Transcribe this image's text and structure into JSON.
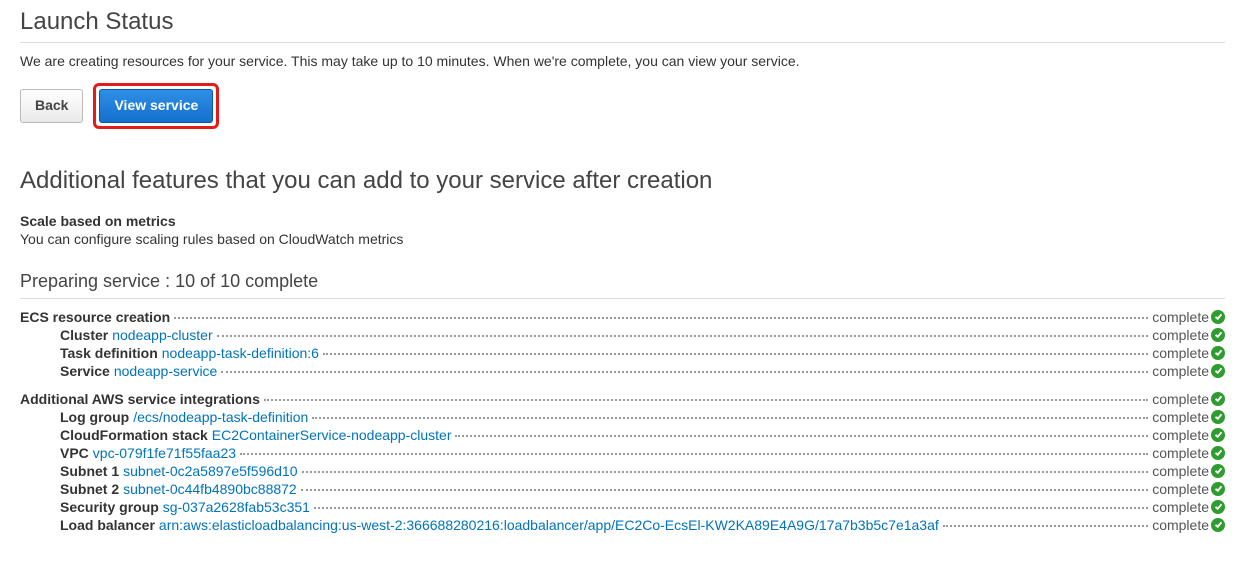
{
  "title": "Launch Status",
  "description": "We are creating resources for your service. This may take up to 10 minutes. When we're complete, you can view your service.",
  "buttons": {
    "back": "Back",
    "view_service": "View service"
  },
  "additional_heading": "Additional features that you can add to your service after creation",
  "feature": {
    "title": "Scale based on metrics",
    "desc": "You can configure scaling rules based on CloudWatch metrics"
  },
  "progress": {
    "heading": "Preparing service : 10 of 10 complete",
    "complete_label": "complete",
    "groups": [
      {
        "title": "ECS resource creation",
        "items": [
          {
            "label": "Cluster",
            "link": "nodeapp-cluster"
          },
          {
            "label": "Task definition",
            "link": "nodeapp-task-definition:6"
          },
          {
            "label": "Service",
            "link": "nodeapp-service"
          }
        ]
      },
      {
        "title": "Additional AWS service integrations",
        "items": [
          {
            "label": "Log group",
            "link": "/ecs/nodeapp-task-definition"
          },
          {
            "label": "CloudFormation stack",
            "link": "EC2ContainerService-nodeapp-cluster"
          },
          {
            "label": "VPC",
            "link": "vpc-079f1fe71f55faa23"
          },
          {
            "label": "Subnet 1",
            "link": "subnet-0c2a5897e5f596d10"
          },
          {
            "label": "Subnet 2",
            "link": "subnet-0c44fb4890bc88872"
          },
          {
            "label": "Security group",
            "link": "sg-037a2628fab53c351"
          },
          {
            "label": "Load balancer",
            "link": "arn:aws:elasticloadbalancing:us-west-2:366688280216:loadbalancer/app/EC2Co-EcsEl-KW2KA89E4A9G/17a7b3b5c7e1a3af"
          }
        ]
      }
    ]
  }
}
